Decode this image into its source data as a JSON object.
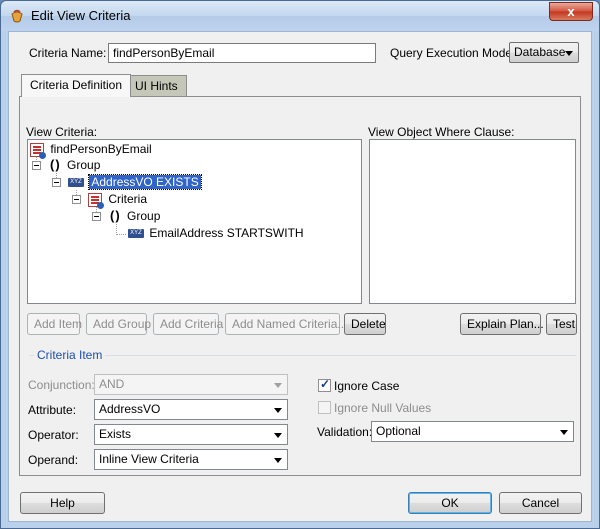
{
  "window": {
    "title": "Edit View Criteria",
    "close_label": "x"
  },
  "criteria_name": {
    "label": "Criteria Name:",
    "value": "findPersonByEmail"
  },
  "query_execution_mode": {
    "label": "Query Execution Mode:",
    "value": "Database"
  },
  "tabs": [
    {
      "label": "Criteria Definition",
      "active": true
    },
    {
      "label": "UI Hints",
      "active": false
    }
  ],
  "view_criteria": {
    "label": "View Criteria:",
    "tree": {
      "root": "findPersonByEmail",
      "group1": "Group",
      "exists_node": "AddressVO EXISTS",
      "criteria_node": "Criteria",
      "group2": "Group",
      "leaf": "EmailAddress STARTSWITH"
    },
    "xyz_badge": "XYZ"
  },
  "where_clause": {
    "label": "View Object Where Clause:"
  },
  "buttons": {
    "add_item": "Add Item",
    "add_group": "Add Group",
    "add_criteria": "Add Criteria",
    "add_named_criteria": "Add Named Criteria...",
    "delete": "Delete",
    "explain_plan": "Explain Plan...",
    "test": "Test",
    "help": "Help",
    "ok": "OK",
    "cancel": "Cancel"
  },
  "criteria_item": {
    "section_title": "Criteria Item",
    "conjunction": {
      "label": "Conjunction:",
      "value": "AND"
    },
    "attribute": {
      "label": "Attribute:",
      "value": "AddressVO"
    },
    "operator": {
      "label": "Operator:",
      "value": "Exists"
    },
    "operand": {
      "label": "Operand:",
      "value": "Inline View Criteria"
    },
    "ignore_case": {
      "label": "Ignore Case",
      "checked": true
    },
    "ignore_null_values": {
      "label": "Ignore Null Values",
      "checked": false
    },
    "validation": {
      "label": "Validation:",
      "value": "Optional"
    }
  },
  "colors": {
    "selection": "#3064c8",
    "section_title": "#1e4fa8",
    "title_bar": "#c3d7ef"
  }
}
